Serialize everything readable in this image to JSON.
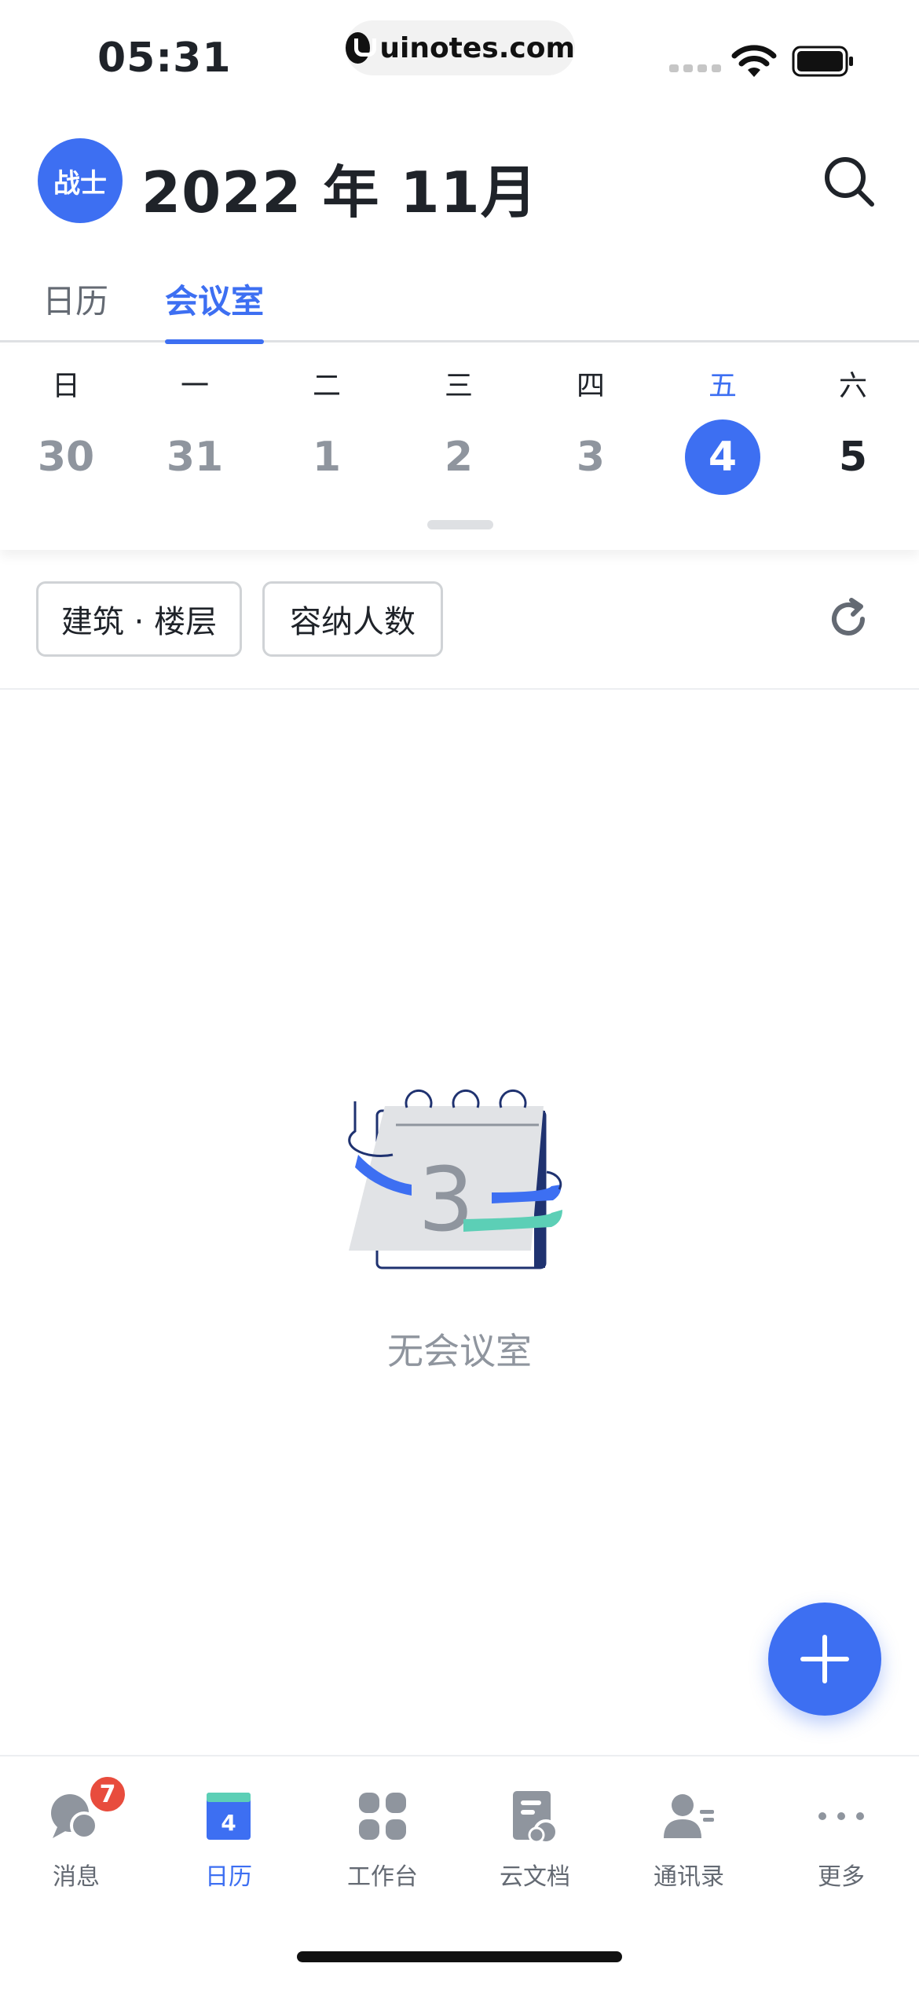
{
  "status_bar": {
    "time": "05:31",
    "url": "uinotes.com"
  },
  "header": {
    "avatar_text": "战士",
    "title": "2022 年 11月"
  },
  "tabs": [
    {
      "label": "日历",
      "active": false
    },
    {
      "label": "会议室",
      "active": true
    }
  ],
  "week": [
    {
      "name": "日",
      "num": "30"
    },
    {
      "name": "一",
      "num": "31"
    },
    {
      "name": "二",
      "num": "1"
    },
    {
      "name": "三",
      "num": "2"
    },
    {
      "name": "四",
      "num": "3"
    },
    {
      "name": "五",
      "num": "4",
      "selected": true
    },
    {
      "name": "六",
      "num": "5"
    }
  ],
  "filters": {
    "building": "建筑 · 楼层",
    "capacity": "容纳人数"
  },
  "empty_state": {
    "illustration_number": "3",
    "text": "无会议室"
  },
  "bottom_nav": [
    {
      "label": "消息",
      "icon": "message-icon",
      "badge": "7"
    },
    {
      "label": "日历",
      "icon": "calendar-icon",
      "icon_text": "4",
      "active": true
    },
    {
      "label": "工作台",
      "icon": "workbench-icon"
    },
    {
      "label": "云文档",
      "icon": "cloud-doc-icon"
    },
    {
      "label": "通讯录",
      "icon": "contacts-icon"
    },
    {
      "label": "更多",
      "icon": "more-icon"
    }
  ],
  "colors": {
    "accent": "#3d6ff2",
    "badge": "#e84c3d",
    "teal": "#5ccfb6",
    "navy": "#1f3270"
  }
}
